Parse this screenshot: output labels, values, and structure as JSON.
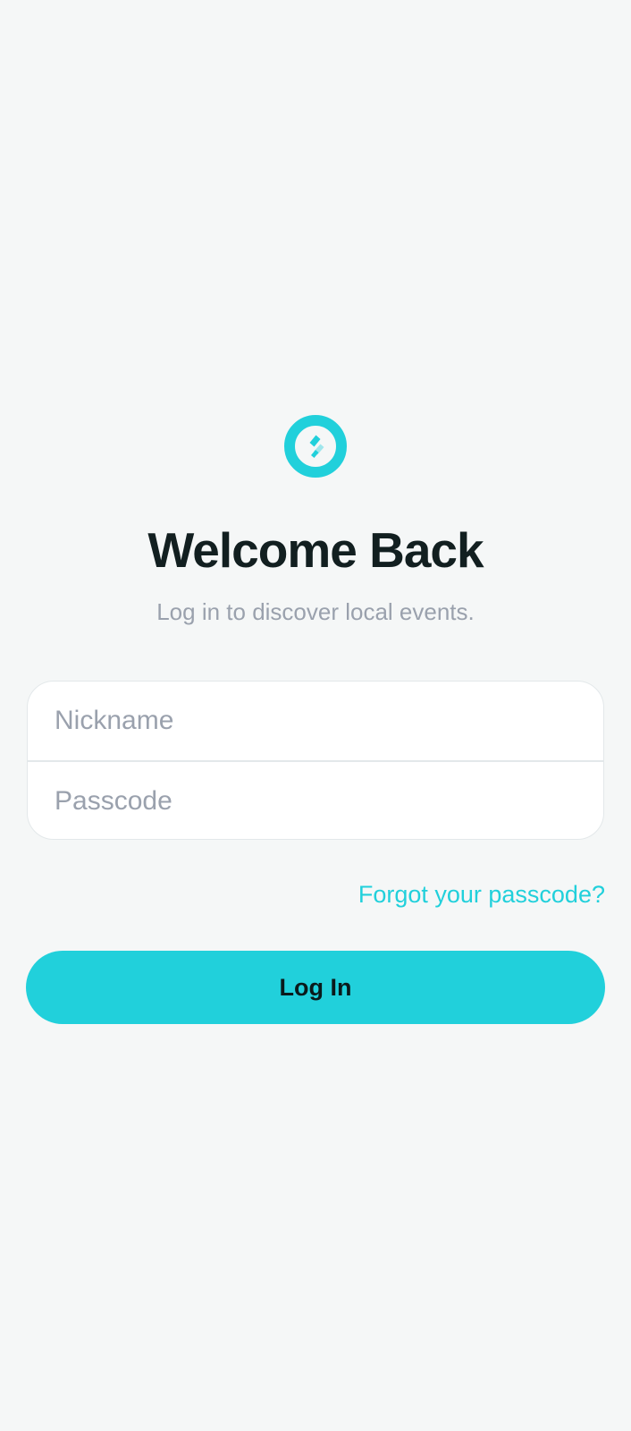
{
  "app": {
    "accent_color": "#21d0db",
    "background_color": "#f5f7f7",
    "logo_icon": "app-logo-icon"
  },
  "header": {
    "title": "Welcome Back",
    "subtitle": "Log in to discover local events."
  },
  "form": {
    "nickname": {
      "value": "",
      "placeholder": "Nickname"
    },
    "passcode": {
      "value": "",
      "placeholder": "Passcode"
    }
  },
  "links": {
    "forgot_passcode": "Forgot your passcode?"
  },
  "actions": {
    "login_label": "Log In"
  }
}
